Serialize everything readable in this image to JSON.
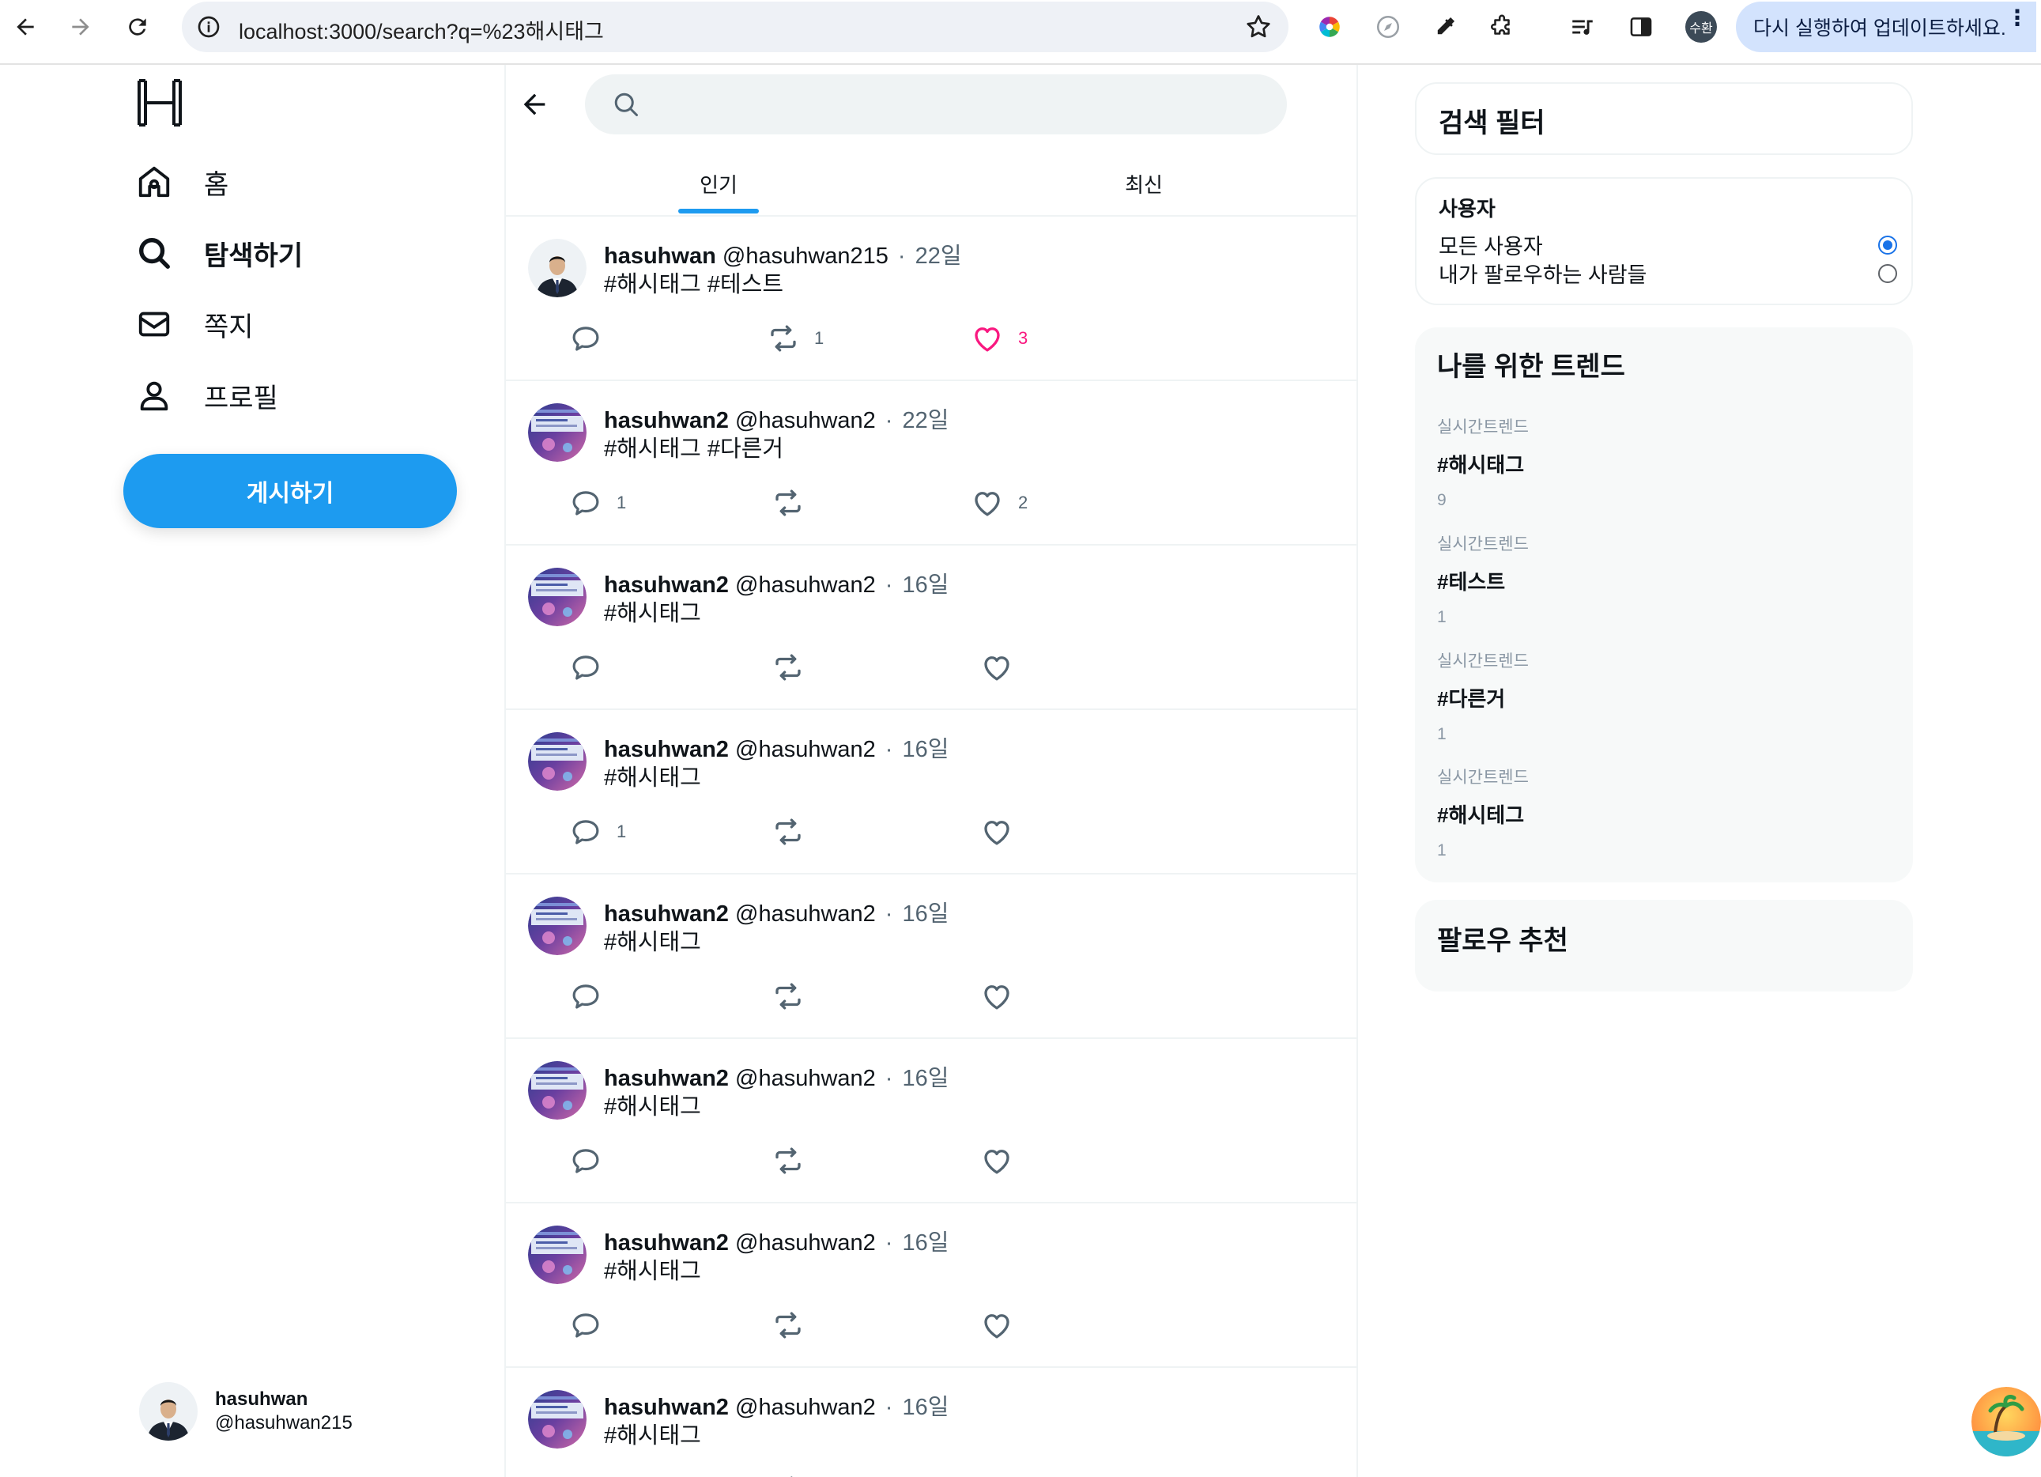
{
  "browser": {
    "url": "localhost:3000/search?q=%23해시태그",
    "profile_initial": "수환",
    "update_label": "다시 실행하여 업데이트하세요."
  },
  "sidebar": {
    "nav": [
      {
        "label": "홈",
        "icon": "home-icon",
        "bold": false
      },
      {
        "label": "탐색하기",
        "icon": "search-icon",
        "bold": true
      },
      {
        "label": "쪽지",
        "icon": "mail-icon",
        "bold": false
      },
      {
        "label": "프로필",
        "icon": "profile-icon",
        "bold": false
      }
    ],
    "post_button": "게시하기",
    "current_user": {
      "name": "hasuhwan",
      "handle": "@hasuhwan215"
    }
  },
  "search": {
    "placeholder": ""
  },
  "tabs": [
    {
      "label": "인기",
      "active": true
    },
    {
      "label": "최신",
      "active": false
    }
  ],
  "posts": [
    {
      "name": "hasuhwan",
      "handle": "@hasuhwan215",
      "time": "22일",
      "text": "#해시태그 #테스트",
      "avatar": "person",
      "replies": "",
      "retweets": "1",
      "likes": "3",
      "liked": true
    },
    {
      "name": "hasuhwan2",
      "handle": "@hasuhwan2",
      "time": "22일",
      "text": "#해시태그 #다른거",
      "avatar": "screen",
      "replies": "1",
      "retweets": "",
      "likes": "2",
      "liked": false
    },
    {
      "name": "hasuhwan2",
      "handle": "@hasuhwan2",
      "time": "16일",
      "text": "#해시태그",
      "avatar": "screen",
      "replies": "",
      "retweets": "",
      "likes": "",
      "liked": false
    },
    {
      "name": "hasuhwan2",
      "handle": "@hasuhwan2",
      "time": "16일",
      "text": "#해시태그",
      "avatar": "screen",
      "replies": "1",
      "retweets": "",
      "likes": "",
      "liked": false
    },
    {
      "name": "hasuhwan2",
      "handle": "@hasuhwan2",
      "time": "16일",
      "text": "#해시태그",
      "avatar": "screen",
      "replies": "",
      "retweets": "",
      "likes": "",
      "liked": false
    },
    {
      "name": "hasuhwan2",
      "handle": "@hasuhwan2",
      "time": "16일",
      "text": "#해시태그",
      "avatar": "screen",
      "replies": "",
      "retweets": "",
      "likes": "",
      "liked": false
    },
    {
      "name": "hasuhwan2",
      "handle": "@hasuhwan2",
      "time": "16일",
      "text": "#해시태그",
      "avatar": "screen",
      "replies": "",
      "retweets": "",
      "likes": "",
      "liked": false
    },
    {
      "name": "hasuhwan2",
      "handle": "@hasuhwan2",
      "time": "16일",
      "text": "#해시태그",
      "avatar": "screen",
      "replies": "",
      "retweets": "",
      "likes": "",
      "liked": false
    }
  ],
  "right": {
    "filter_title": "검색 필터",
    "user_filter": {
      "title": "사용자",
      "options": [
        {
          "label": "모든 사용자",
          "selected": true
        },
        {
          "label": "내가 팔로우하는 사람들",
          "selected": false
        }
      ]
    },
    "trends_title": "나를 위한 트렌드",
    "trends": [
      {
        "category": "실시간트렌드",
        "tag": "#해시태그",
        "count": "9"
      },
      {
        "category": "실시간트렌드",
        "tag": "#테스트",
        "count": "1"
      },
      {
        "category": "실시간트렌드",
        "tag": "#다른거",
        "count": "1"
      },
      {
        "category": "실시간트렌드",
        "tag": "#해시테그",
        "count": "1"
      }
    ],
    "follow_title": "팔로우 추천"
  },
  "colors": {
    "accent": "#1d9bf0",
    "like": "#f91880",
    "muted": "#536471"
  }
}
